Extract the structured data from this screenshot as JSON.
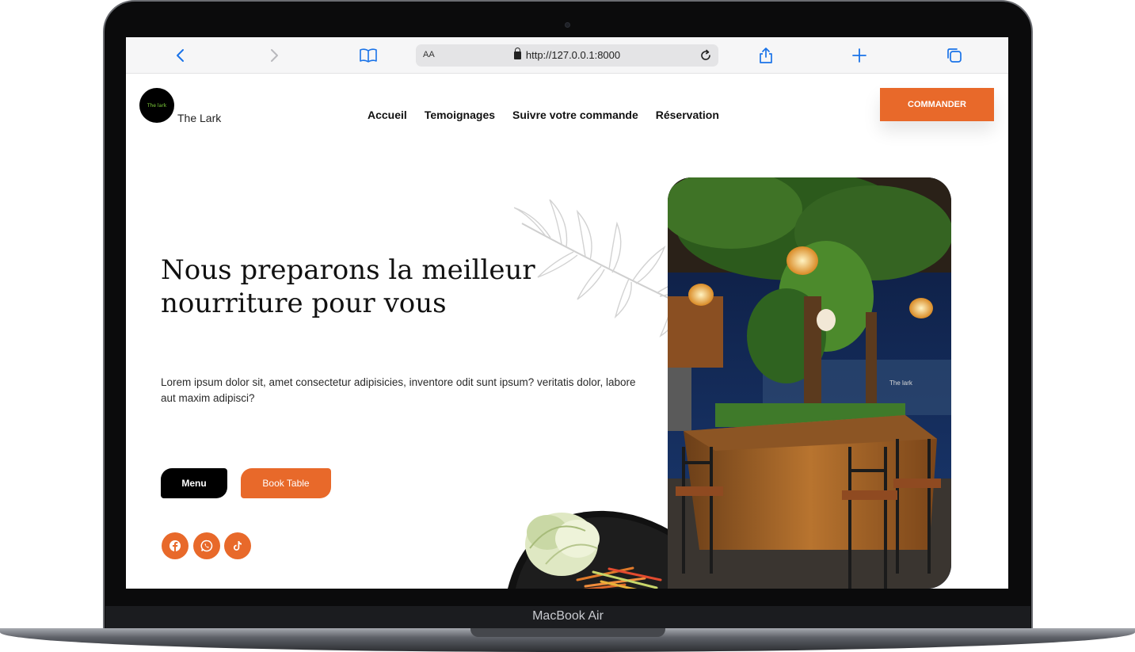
{
  "device": {
    "label": "MacBook Air"
  },
  "browser": {
    "address_prefix": "AA",
    "url": "http://127.0.0.1:8000",
    "icons": [
      "back-icon",
      "forward-icon",
      "bookmarks-icon",
      "lock-icon",
      "reload-icon",
      "share-icon",
      "new-tab-icon",
      "tabs-icon"
    ]
  },
  "site": {
    "brand": "The Lark",
    "logo_text": "The lark",
    "nav": [
      "Accueil",
      "Temoignages",
      "Suivre votre commande",
      "Réservation"
    ],
    "order_button": "COMMANDER",
    "hero": {
      "title_line1": "Nous preparons la meilleur",
      "title_line2": "nourriture pour vous",
      "description": "Lorem ipsum dolor sit, amet consectetur adipisicies, inventore odit sunt ipsum? veritatis dolor, labore aut maxim adipisci?",
      "menu_button": "Menu",
      "book_button": "Book Table"
    },
    "social": [
      "facebook-icon",
      "whatsapp-icon",
      "tiktok-icon"
    ],
    "photo_sign": "The lark",
    "accent_color": "#e8692a"
  }
}
